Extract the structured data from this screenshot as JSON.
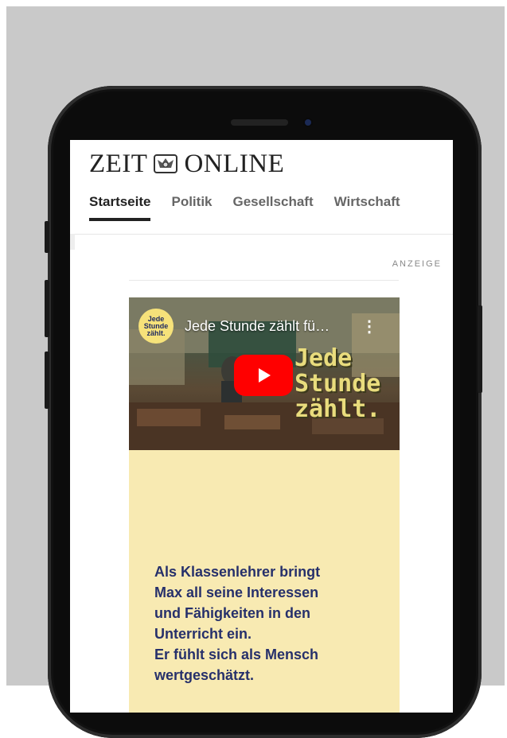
{
  "site": {
    "logo_left": "ZEIT",
    "logo_right": "ONLINE"
  },
  "nav": {
    "tabs": [
      {
        "label": "Startseite",
        "active": true
      },
      {
        "label": "Politik"
      },
      {
        "label": "Gesellschaft"
      },
      {
        "label": "Wirtschaft"
      }
    ]
  },
  "ad": {
    "label": "ANZEIGE",
    "video": {
      "title": "Jede Stunde zählt fü…",
      "channel_badge": [
        "Jede",
        "Stunde",
        "zählt."
      ],
      "overlay_lines": [
        "Jede",
        "Stunde",
        "zählt."
      ],
      "play_color": "#ff0000"
    },
    "text_lines": [
      "Als Klassenlehrer bringt",
      "Max all seine Interessen",
      "und Fähigkeiten in den",
      "Unterricht ein.",
      "Er fühlt sich als Mensch",
      "wertgeschätzt."
    ],
    "background": "#f8eab2",
    "text_color": "#26306b"
  }
}
